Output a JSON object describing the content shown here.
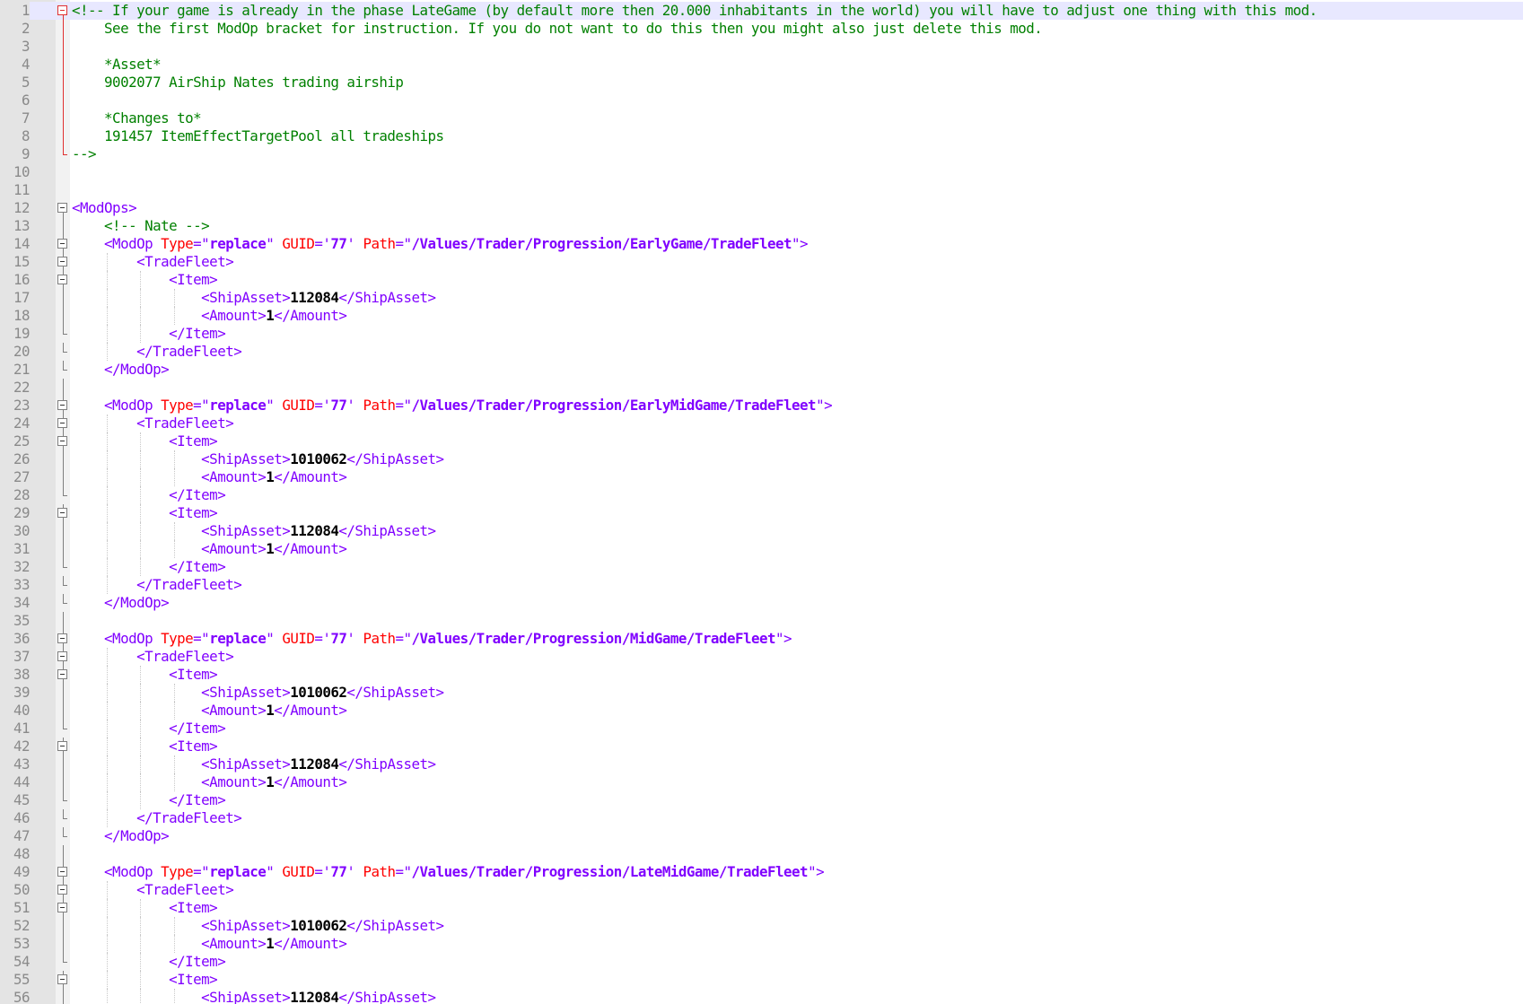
{
  "editor": {
    "current_line": 1,
    "lines": [
      {
        "n": "1",
        "fold": "start",
        "red": true,
        "guides": 0,
        "segments": [
          {
            "t": "comment",
            "v": "<!-- If your game is already in the phase LateGame (by default more then 20.000 inhabitants in the world) you will have to adjust one thing with this mod."
          }
        ]
      },
      {
        "n": "2",
        "fold": "line",
        "red": true,
        "guides": 0,
        "segments": [
          {
            "t": "comment",
            "v": "    See the first ModOp bracket for instruction. If you do not want to do this then you might also just delete this mod."
          }
        ]
      },
      {
        "n": "3",
        "fold": "line",
        "red": true,
        "guides": 0,
        "segments": []
      },
      {
        "n": "4",
        "fold": "line",
        "red": true,
        "guides": 0,
        "segments": [
          {
            "t": "comment",
            "v": "    *Asset*"
          }
        ]
      },
      {
        "n": "5",
        "fold": "line",
        "red": true,
        "guides": 0,
        "segments": [
          {
            "t": "comment",
            "v": "    9002077 AirShip Nates trading airship"
          }
        ]
      },
      {
        "n": "6",
        "fold": "line",
        "red": true,
        "guides": 0,
        "segments": []
      },
      {
        "n": "7",
        "fold": "line",
        "red": true,
        "guides": 0,
        "segments": [
          {
            "t": "comment",
            "v": "    *Changes to*"
          }
        ]
      },
      {
        "n": "8",
        "fold": "line",
        "red": true,
        "guides": 0,
        "segments": [
          {
            "t": "comment",
            "v": "    191457 ItemEffectTargetPool all tradeships"
          }
        ]
      },
      {
        "n": "9",
        "fold": "end",
        "red": true,
        "guides": 0,
        "segments": [
          {
            "t": "comment",
            "v": "-->"
          }
        ]
      },
      {
        "n": "10",
        "fold": "none",
        "guides": 0,
        "segments": []
      },
      {
        "n": "11",
        "fold": "none",
        "guides": 0,
        "segments": []
      },
      {
        "n": "12",
        "fold": "start",
        "guides": 0,
        "segments": [
          {
            "t": "tag",
            "v": "<ModOps>"
          }
        ]
      },
      {
        "n": "13",
        "fold": "line",
        "guides": 0,
        "segments": [
          {
            "t": "comment",
            "v": "    <!-- Nate -->"
          }
        ]
      },
      {
        "n": "14",
        "fold": "start",
        "guides": 0,
        "segments": [
          {
            "t": "tag",
            "v": "    <ModOp "
          },
          {
            "t": "attr",
            "v": "Type"
          },
          {
            "t": "tag",
            "v": "=\""
          },
          {
            "t": "val",
            "v": "replace"
          },
          {
            "t": "tag",
            "v": "\" "
          },
          {
            "t": "attr",
            "v": "GUID"
          },
          {
            "t": "tag",
            "v": "='"
          },
          {
            "t": "val",
            "v": "77"
          },
          {
            "t": "tag",
            "v": "' "
          },
          {
            "t": "attr",
            "v": "Path"
          },
          {
            "t": "tag",
            "v": "=\""
          },
          {
            "t": "val",
            "v": "/Values/Trader/Progression/EarlyGame/TradeFleet"
          },
          {
            "t": "tag",
            "v": "\">"
          }
        ]
      },
      {
        "n": "15",
        "fold": "start",
        "guides": 1,
        "segments": [
          {
            "t": "tag",
            "v": "        <TradeFleet>"
          }
        ]
      },
      {
        "n": "16",
        "fold": "start",
        "guides": 2,
        "segments": [
          {
            "t": "tag",
            "v": "            <Item>"
          }
        ]
      },
      {
        "n": "17",
        "fold": "line",
        "guides": 3,
        "segments": [
          {
            "t": "tag",
            "v": "                <ShipAsset>"
          },
          {
            "t": "num",
            "v": "112084"
          },
          {
            "t": "tag",
            "v": "</ShipAsset>"
          }
        ]
      },
      {
        "n": "18",
        "fold": "line",
        "guides": 3,
        "segments": [
          {
            "t": "tag",
            "v": "                <Amount>"
          },
          {
            "t": "num",
            "v": "1"
          },
          {
            "t": "tag",
            "v": "</Amount>"
          }
        ]
      },
      {
        "n": "19",
        "fold": "end",
        "guides": 2,
        "segments": [
          {
            "t": "tag",
            "v": "            </Item>"
          }
        ]
      },
      {
        "n": "20",
        "fold": "end",
        "guides": 1,
        "segments": [
          {
            "t": "tag",
            "v": "        </TradeFleet>"
          }
        ]
      },
      {
        "n": "21",
        "fold": "end",
        "guides": 0,
        "segments": [
          {
            "t": "tag",
            "v": "    </ModOp>"
          }
        ]
      },
      {
        "n": "22",
        "fold": "line",
        "guides": 0,
        "segments": []
      },
      {
        "n": "23",
        "fold": "start",
        "guides": 0,
        "segments": [
          {
            "t": "tag",
            "v": "    <ModOp "
          },
          {
            "t": "attr",
            "v": "Type"
          },
          {
            "t": "tag",
            "v": "=\""
          },
          {
            "t": "val",
            "v": "replace"
          },
          {
            "t": "tag",
            "v": "\" "
          },
          {
            "t": "attr",
            "v": "GUID"
          },
          {
            "t": "tag",
            "v": "='"
          },
          {
            "t": "val",
            "v": "77"
          },
          {
            "t": "tag",
            "v": "' "
          },
          {
            "t": "attr",
            "v": "Path"
          },
          {
            "t": "tag",
            "v": "=\""
          },
          {
            "t": "val",
            "v": "/Values/Trader/Progression/EarlyMidGame/TradeFleet"
          },
          {
            "t": "tag",
            "v": "\">"
          }
        ]
      },
      {
        "n": "24",
        "fold": "start",
        "guides": 1,
        "segments": [
          {
            "t": "tag",
            "v": "        <TradeFleet>"
          }
        ]
      },
      {
        "n": "25",
        "fold": "start",
        "guides": 2,
        "segments": [
          {
            "t": "tag",
            "v": "            <Item>"
          }
        ]
      },
      {
        "n": "26",
        "fold": "line",
        "guides": 3,
        "segments": [
          {
            "t": "tag",
            "v": "                <ShipAsset>"
          },
          {
            "t": "num",
            "v": "1010062"
          },
          {
            "t": "tag",
            "v": "</ShipAsset>"
          }
        ]
      },
      {
        "n": "27",
        "fold": "line",
        "guides": 3,
        "segments": [
          {
            "t": "tag",
            "v": "                <Amount>"
          },
          {
            "t": "num",
            "v": "1"
          },
          {
            "t": "tag",
            "v": "</Amount>"
          }
        ]
      },
      {
        "n": "28",
        "fold": "end",
        "guides": 2,
        "segments": [
          {
            "t": "tag",
            "v": "            </Item>"
          }
        ]
      },
      {
        "n": "29",
        "fold": "start",
        "guides": 2,
        "segments": [
          {
            "t": "tag",
            "v": "            <Item>"
          }
        ]
      },
      {
        "n": "30",
        "fold": "line",
        "guides": 3,
        "segments": [
          {
            "t": "tag",
            "v": "                <ShipAsset>"
          },
          {
            "t": "num",
            "v": "112084"
          },
          {
            "t": "tag",
            "v": "</ShipAsset>"
          }
        ]
      },
      {
        "n": "31",
        "fold": "line",
        "guides": 3,
        "segments": [
          {
            "t": "tag",
            "v": "                <Amount>"
          },
          {
            "t": "num",
            "v": "1"
          },
          {
            "t": "tag",
            "v": "</Amount>"
          }
        ]
      },
      {
        "n": "32",
        "fold": "end",
        "guides": 2,
        "segments": [
          {
            "t": "tag",
            "v": "            </Item>"
          }
        ]
      },
      {
        "n": "33",
        "fold": "end",
        "guides": 1,
        "segments": [
          {
            "t": "tag",
            "v": "        </TradeFleet>"
          }
        ]
      },
      {
        "n": "34",
        "fold": "end",
        "guides": 0,
        "segments": [
          {
            "t": "tag",
            "v": "    </ModOp>"
          }
        ]
      },
      {
        "n": "35",
        "fold": "line",
        "guides": 0,
        "segments": []
      },
      {
        "n": "36",
        "fold": "start",
        "guides": 0,
        "segments": [
          {
            "t": "tag",
            "v": "    <ModOp "
          },
          {
            "t": "attr",
            "v": "Type"
          },
          {
            "t": "tag",
            "v": "=\""
          },
          {
            "t": "val",
            "v": "replace"
          },
          {
            "t": "tag",
            "v": "\" "
          },
          {
            "t": "attr",
            "v": "GUID"
          },
          {
            "t": "tag",
            "v": "='"
          },
          {
            "t": "val",
            "v": "77"
          },
          {
            "t": "tag",
            "v": "' "
          },
          {
            "t": "attr",
            "v": "Path"
          },
          {
            "t": "tag",
            "v": "=\""
          },
          {
            "t": "val",
            "v": "/Values/Trader/Progression/MidGame/TradeFleet"
          },
          {
            "t": "tag",
            "v": "\">"
          }
        ]
      },
      {
        "n": "37",
        "fold": "start",
        "guides": 1,
        "segments": [
          {
            "t": "tag",
            "v": "        <TradeFleet>"
          }
        ]
      },
      {
        "n": "38",
        "fold": "start",
        "guides": 2,
        "segments": [
          {
            "t": "tag",
            "v": "            <Item>"
          }
        ]
      },
      {
        "n": "39",
        "fold": "line",
        "guides": 3,
        "segments": [
          {
            "t": "tag",
            "v": "                <ShipAsset>"
          },
          {
            "t": "num",
            "v": "1010062"
          },
          {
            "t": "tag",
            "v": "</ShipAsset>"
          }
        ]
      },
      {
        "n": "40",
        "fold": "line",
        "guides": 3,
        "segments": [
          {
            "t": "tag",
            "v": "                <Amount>"
          },
          {
            "t": "num",
            "v": "1"
          },
          {
            "t": "tag",
            "v": "</Amount>"
          }
        ]
      },
      {
        "n": "41",
        "fold": "end",
        "guides": 2,
        "segments": [
          {
            "t": "tag",
            "v": "            </Item>"
          }
        ]
      },
      {
        "n": "42",
        "fold": "start",
        "guides": 2,
        "segments": [
          {
            "t": "tag",
            "v": "            <Item>"
          }
        ]
      },
      {
        "n": "43",
        "fold": "line",
        "guides": 3,
        "segments": [
          {
            "t": "tag",
            "v": "                <ShipAsset>"
          },
          {
            "t": "num",
            "v": "112084"
          },
          {
            "t": "tag",
            "v": "</ShipAsset>"
          }
        ]
      },
      {
        "n": "44",
        "fold": "line",
        "guides": 3,
        "segments": [
          {
            "t": "tag",
            "v": "                <Amount>"
          },
          {
            "t": "num",
            "v": "1"
          },
          {
            "t": "tag",
            "v": "</Amount>"
          }
        ]
      },
      {
        "n": "45",
        "fold": "end",
        "guides": 2,
        "segments": [
          {
            "t": "tag",
            "v": "            </Item>"
          }
        ]
      },
      {
        "n": "46",
        "fold": "end",
        "guides": 1,
        "segments": [
          {
            "t": "tag",
            "v": "        </TradeFleet>"
          }
        ]
      },
      {
        "n": "47",
        "fold": "end",
        "guides": 0,
        "segments": [
          {
            "t": "tag",
            "v": "    </ModOp>"
          }
        ]
      },
      {
        "n": "48",
        "fold": "line",
        "guides": 0,
        "segments": []
      },
      {
        "n": "49",
        "fold": "start",
        "guides": 0,
        "segments": [
          {
            "t": "tag",
            "v": "    <ModOp "
          },
          {
            "t": "attr",
            "v": "Type"
          },
          {
            "t": "tag",
            "v": "=\""
          },
          {
            "t": "val",
            "v": "replace"
          },
          {
            "t": "tag",
            "v": "\" "
          },
          {
            "t": "attr",
            "v": "GUID"
          },
          {
            "t": "tag",
            "v": "='"
          },
          {
            "t": "val",
            "v": "77"
          },
          {
            "t": "tag",
            "v": "' "
          },
          {
            "t": "attr",
            "v": "Path"
          },
          {
            "t": "tag",
            "v": "=\""
          },
          {
            "t": "val",
            "v": "/Values/Trader/Progression/LateMidGame/TradeFleet"
          },
          {
            "t": "tag",
            "v": "\">"
          }
        ]
      },
      {
        "n": "50",
        "fold": "start",
        "guides": 1,
        "segments": [
          {
            "t": "tag",
            "v": "        <TradeFleet>"
          }
        ]
      },
      {
        "n": "51",
        "fold": "start",
        "guides": 2,
        "segments": [
          {
            "t": "tag",
            "v": "            <Item>"
          }
        ]
      },
      {
        "n": "52",
        "fold": "line",
        "guides": 3,
        "segments": [
          {
            "t": "tag",
            "v": "                <ShipAsset>"
          },
          {
            "t": "num",
            "v": "1010062"
          },
          {
            "t": "tag",
            "v": "</ShipAsset>"
          }
        ]
      },
      {
        "n": "53",
        "fold": "line",
        "guides": 3,
        "segments": [
          {
            "t": "tag",
            "v": "                <Amount>"
          },
          {
            "t": "num",
            "v": "1"
          },
          {
            "t": "tag",
            "v": "</Amount>"
          }
        ]
      },
      {
        "n": "54",
        "fold": "end",
        "guides": 2,
        "segments": [
          {
            "t": "tag",
            "v": "            </Item>"
          }
        ]
      },
      {
        "n": "55",
        "fold": "start",
        "guides": 2,
        "segments": [
          {
            "t": "tag",
            "v": "            <Item>"
          }
        ]
      },
      {
        "n": "56",
        "fold": "line",
        "guides": 3,
        "segments": [
          {
            "t": "tag",
            "v": "                <ShipAsset>"
          },
          {
            "t": "num",
            "v": "112084"
          },
          {
            "t": "tag",
            "v": "</ShipAsset>"
          }
        ]
      }
    ]
  }
}
